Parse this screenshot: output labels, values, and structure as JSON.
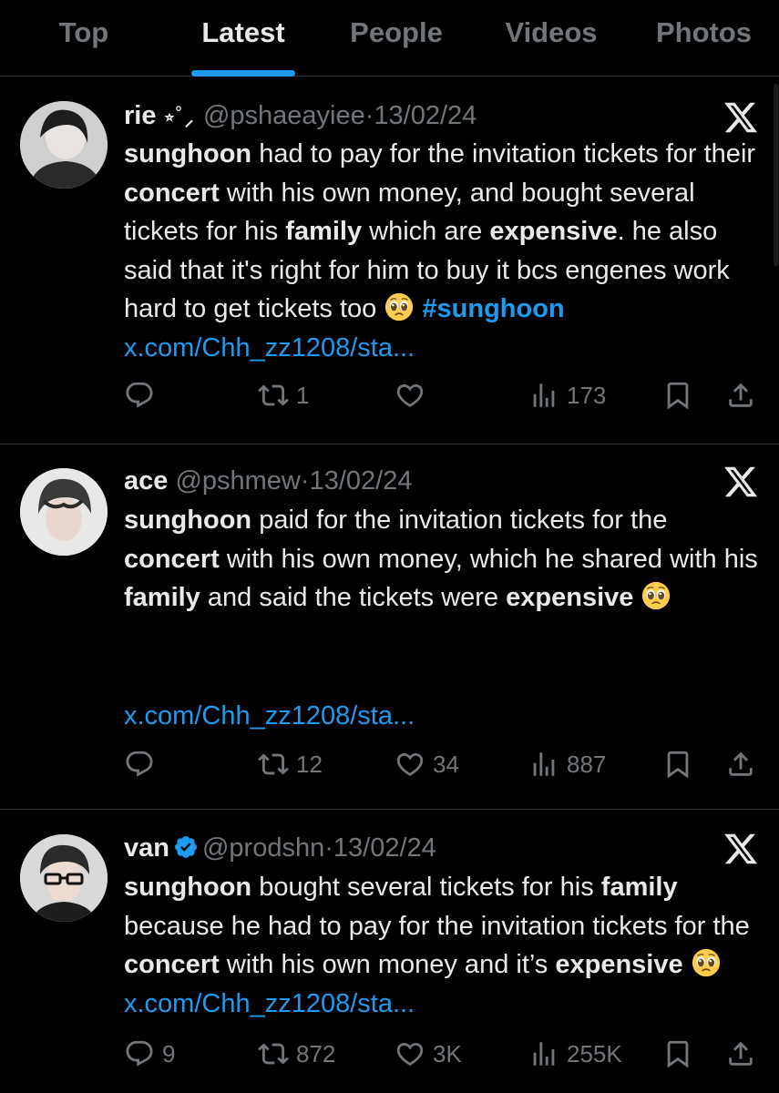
{
  "tabs": [
    {
      "label": "Top",
      "active": false
    },
    {
      "label": "Latest",
      "active": true
    },
    {
      "label": "People",
      "active": false
    },
    {
      "label": "Videos",
      "active": false
    },
    {
      "label": "Photos",
      "active": false
    }
  ],
  "colors": {
    "accent": "#1d9bf0",
    "muted": "#71767b",
    "text": "#e7e9ea",
    "background": "#000000"
  },
  "tweets": [
    {
      "name": "rie",
      "name_suffix": "⭒˚⸝",
      "handle": "@pshaeayiee",
      "separator": "·",
      "date": "13/02/24",
      "verified": false,
      "body": {
        "p1": "sunghoon",
        "p2": " had to pay for the invitation tickets for their ",
        "p3": "concert",
        "p4": " with his own money, and bought several tickets for his ",
        "p5": "family",
        "p6": " which are ",
        "p7": "expensive",
        "p8": ". he also said that it's right for him to buy it bcs engenes work hard to get tickets too ",
        "hashtag": "#sunghoon",
        "link": "x.com/Chh_zz1208/sta..."
      },
      "stats": {
        "replies": "",
        "reposts": "1",
        "likes": "",
        "views": "173"
      },
      "icons": [
        "reply-icon",
        "repost-icon",
        "like-icon",
        "views-icon",
        "bookmark-icon",
        "share-icon",
        "x-logo-icon",
        "pleading-face-emoji"
      ]
    },
    {
      "name": "ace",
      "handle": "@pshmew",
      "separator": "·",
      "date": "13/02/24",
      "verified": false,
      "body": {
        "p1": "sunghoon",
        "p2": " paid for the invitation tickets for the ",
        "p3": "concert",
        "p4": " with his own money, which he shared with his ",
        "p5": "family",
        "p6": " and said the tickets were ",
        "p7": "expensive",
        "link": "x.com/Chh_zz1208/sta..."
      },
      "stats": {
        "replies": "",
        "reposts": "12",
        "likes": "34",
        "views": "887"
      }
    },
    {
      "name": "van",
      "handle": "@prodshn",
      "separator": "·",
      "date": "13/02/24",
      "verified": true,
      "body": {
        "p1": "sunghoon",
        "p2": " bought several tickets for his ",
        "p3": "family",
        "p4": " because he had to pay for the invitation tickets for the ",
        "p5": "concert",
        "p6": " with his own money and it’s ",
        "p7": "expensive",
        "link": "x.com/Chh_zz1208/sta..."
      },
      "stats": {
        "replies": "9",
        "reposts": "872",
        "likes": "3K",
        "views": "255K"
      }
    }
  ]
}
